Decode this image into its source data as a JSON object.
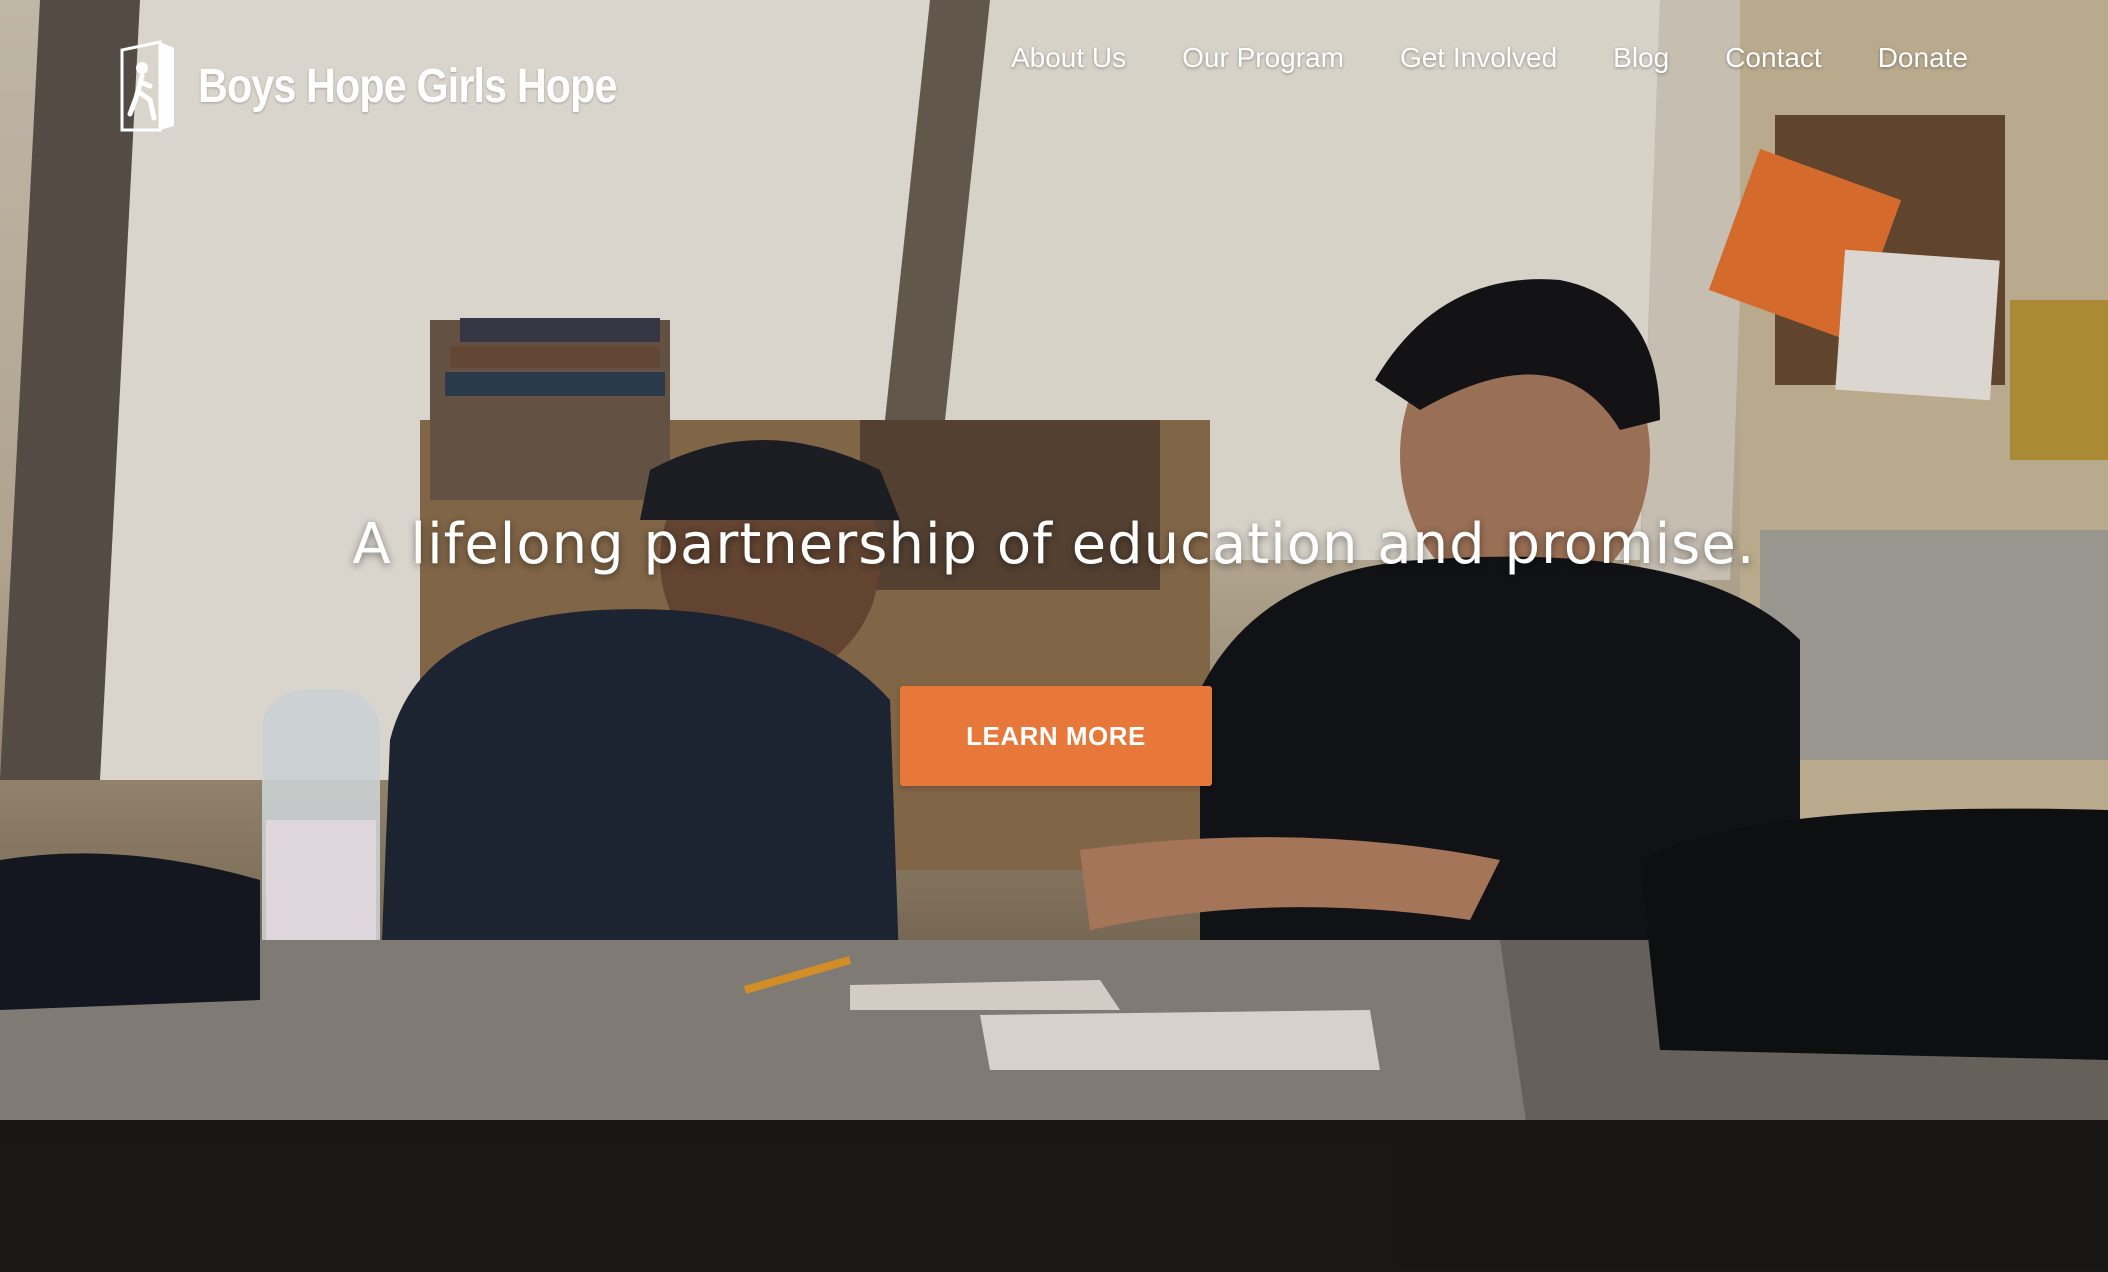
{
  "brand": {
    "name": "Boys Hope Girls Hope",
    "logo_icon": "door-figure-icon"
  },
  "nav": {
    "items": [
      {
        "label": "About Us"
      },
      {
        "label": "Our Program"
      },
      {
        "label": "Get Involved"
      },
      {
        "label": "Blog"
      },
      {
        "label": "Contact"
      },
      {
        "label": "Donate"
      }
    ]
  },
  "hero": {
    "tagline": "A lifelong partnership of education and promise.",
    "cta_label": "LEARN MORE",
    "cta_color": "#e8783a",
    "image_description": "A mentor and a student working together on paper at a desk"
  }
}
